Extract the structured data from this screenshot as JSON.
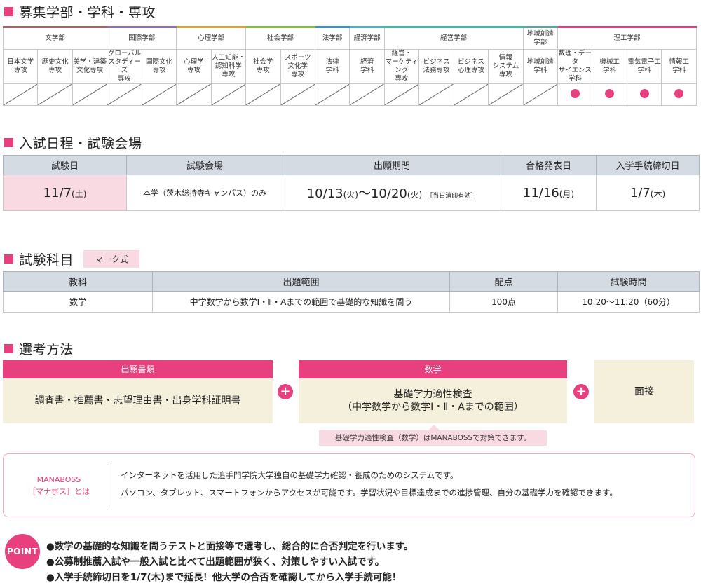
{
  "sections": {
    "departments": "募集学部・学科・専攻",
    "schedule": "入試日程・試験会場",
    "subjects": "試験科目",
    "subjects_badge": "マーク式",
    "selection": "選考方法"
  },
  "faculties": [
    {
      "name": "文学部",
      "color": "#a5656b",
      "span": 3
    },
    {
      "name": "国際学部",
      "color": "#8a72b0",
      "span": 2
    },
    {
      "name": "心理学部",
      "color": "#e0a23c",
      "span": 2
    },
    {
      "name": "社会学部",
      "color": "#83bf3f",
      "span": 2
    },
    {
      "name": "法学部",
      "color": "#3b8fd0",
      "span": 1
    },
    {
      "name": "経済学部",
      "color": "#4ab0c9",
      "span": 1
    },
    {
      "name": "経営学部",
      "color": "#3fb8a8",
      "span": 4
    },
    {
      "name": "地域創造\n学部",
      "color": "#5aa8a0",
      "span": 1
    },
    {
      "name": "理工学部",
      "color": "#e8407f",
      "span": 4
    }
  ],
  "majors": [
    {
      "name": "日本文学\n専攻",
      "eligible": false
    },
    {
      "name": "歴史文化\n専攻",
      "eligible": false
    },
    {
      "name": "美学・建築\n文化専攻",
      "eligible": false
    },
    {
      "name": "グローバル\nスタディーズ\n専攻",
      "eligible": false
    },
    {
      "name": "国際文化\n専攻",
      "eligible": false
    },
    {
      "name": "心理学\n専攻",
      "eligible": false
    },
    {
      "name": "人工知能・\n認知科学\n専攻",
      "eligible": false
    },
    {
      "name": "社会学\n専攻",
      "eligible": false
    },
    {
      "name": "スポーツ\n文化学\n専攻",
      "eligible": false
    },
    {
      "name": "法律\n学科",
      "eligible": false
    },
    {
      "name": "経済\n学科",
      "eligible": false
    },
    {
      "name": "経営・\nマーケティング\n専攻",
      "eligible": false
    },
    {
      "name": "ビジネス\n法務専攻",
      "eligible": false
    },
    {
      "name": "ビジネス\n心理専攻",
      "eligible": false
    },
    {
      "name": "情報\nシステム\n専攻",
      "eligible": false
    },
    {
      "name": "地域創造\n学科",
      "eligible": false
    },
    {
      "name": "数理・データ\nサイエンス\n学科",
      "eligible": true
    },
    {
      "name": "機械工\n学科",
      "eligible": true
    },
    {
      "name": "電気電子工\n学科",
      "eligible": true
    },
    {
      "name": "情報工\n学科",
      "eligible": true
    }
  ],
  "schedule": {
    "headers": [
      "試験日",
      "試験会場",
      "出願期間",
      "合格発表日",
      "入学手続締切日"
    ],
    "exam_date": "11/7",
    "exam_weekday": "(土)",
    "venue": "本学（茨木総持寺キャンパス）のみ",
    "apply_start": "10/13",
    "apply_start_wd": "(火)",
    "apply_sep": "～",
    "apply_end": "10/20",
    "apply_end_wd": "(火)",
    "apply_note": "［当日消印有効］",
    "result_date": "11/16",
    "result_wd": "(月)",
    "deadline": "1/7",
    "deadline_wd": "(木)"
  },
  "subjects": {
    "headers": [
      "教科",
      "出題範囲",
      "配点",
      "試験時間"
    ],
    "row": [
      "数学",
      "中学数学から数学Ⅰ・Ⅱ・Aまでの範囲で基礎的な知識を問う",
      "100点",
      "10:20～11:20（60分）"
    ]
  },
  "selection": {
    "box1_head": "出願書類",
    "box1_body": "調査書・推薦書・志望理由書・出身学科証明書",
    "box2_head": "数学",
    "box2_line1": "基礎学力適性検査",
    "box2_line2": "（中学数学から数学Ⅰ・Ⅱ・Aまでの範囲）",
    "box3_body": "面接",
    "plus": "+",
    "tip": "基礎学力適性検査（数学）はMANABOSSで対策できます。"
  },
  "manaboss": {
    "label1": "MANABOSS",
    "label2": "［マナボス］とは",
    "line1": "インターネットを活用した追手門学院大学独自の基礎学力確認・養成のためのシステムです。",
    "line2": "パソコン、タブレット、スマートフォンからアクセスが可能です。学習状況や目標達成までの進捗管理、自分の基礎学力を確認できます。"
  },
  "point": {
    "badge": "POINT",
    "lines": [
      "●数学の基礎的な知識を問うテストと面接等で選考し、総合的に合否判定を行います。",
      "●公募制推薦入試や一般入試と比べて出題範囲が狭く、対策しやすい入試です。",
      "●入学手続締切日を1/7(木)まで延長！他大学の合否を確認してから入学手続可能！"
    ]
  }
}
